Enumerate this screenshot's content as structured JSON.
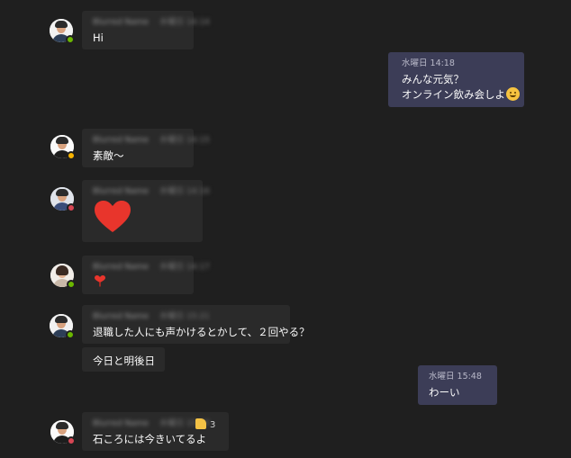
{
  "messages": [
    {
      "sender": "Blurred Name",
      "time": "水曜日 14:14",
      "text": "Hi",
      "status": "available"
    },
    {
      "time": "水曜日 14:18",
      "line1": "みんな元気？",
      "line2": "オンライン飲み会しよ"
    },
    {
      "sender": "Blurred Name",
      "time": "水曜日 14:15",
      "text": "素敵〜",
      "status": "away"
    },
    {
      "sender": "Blurred Name",
      "time": "水曜日 14:16",
      "status": "busy"
    },
    {
      "sender": "Blurred Name",
      "time": "水曜日 14:17",
      "status": "available"
    },
    {
      "sender": "Blurred Name",
      "time": "水曜日 15:21",
      "text": "退職した人にも声かけるとかして、２回やる？",
      "status": "available"
    },
    {
      "text": "今日と明後日"
    },
    {
      "time": "水曜日 15:48",
      "text": "わーい"
    },
    {
      "sender": "Blurred Name",
      "time": "水曜日 15:50",
      "text": "石ころには今きいてるよ",
      "reaction_count": "3",
      "status": "busy"
    }
  ],
  "colors": {
    "background": "#1f1f1f",
    "incoming_bubble": "#2a2a2a",
    "outgoing_bubble": "#3c3d57",
    "heart": "#e8352c"
  }
}
